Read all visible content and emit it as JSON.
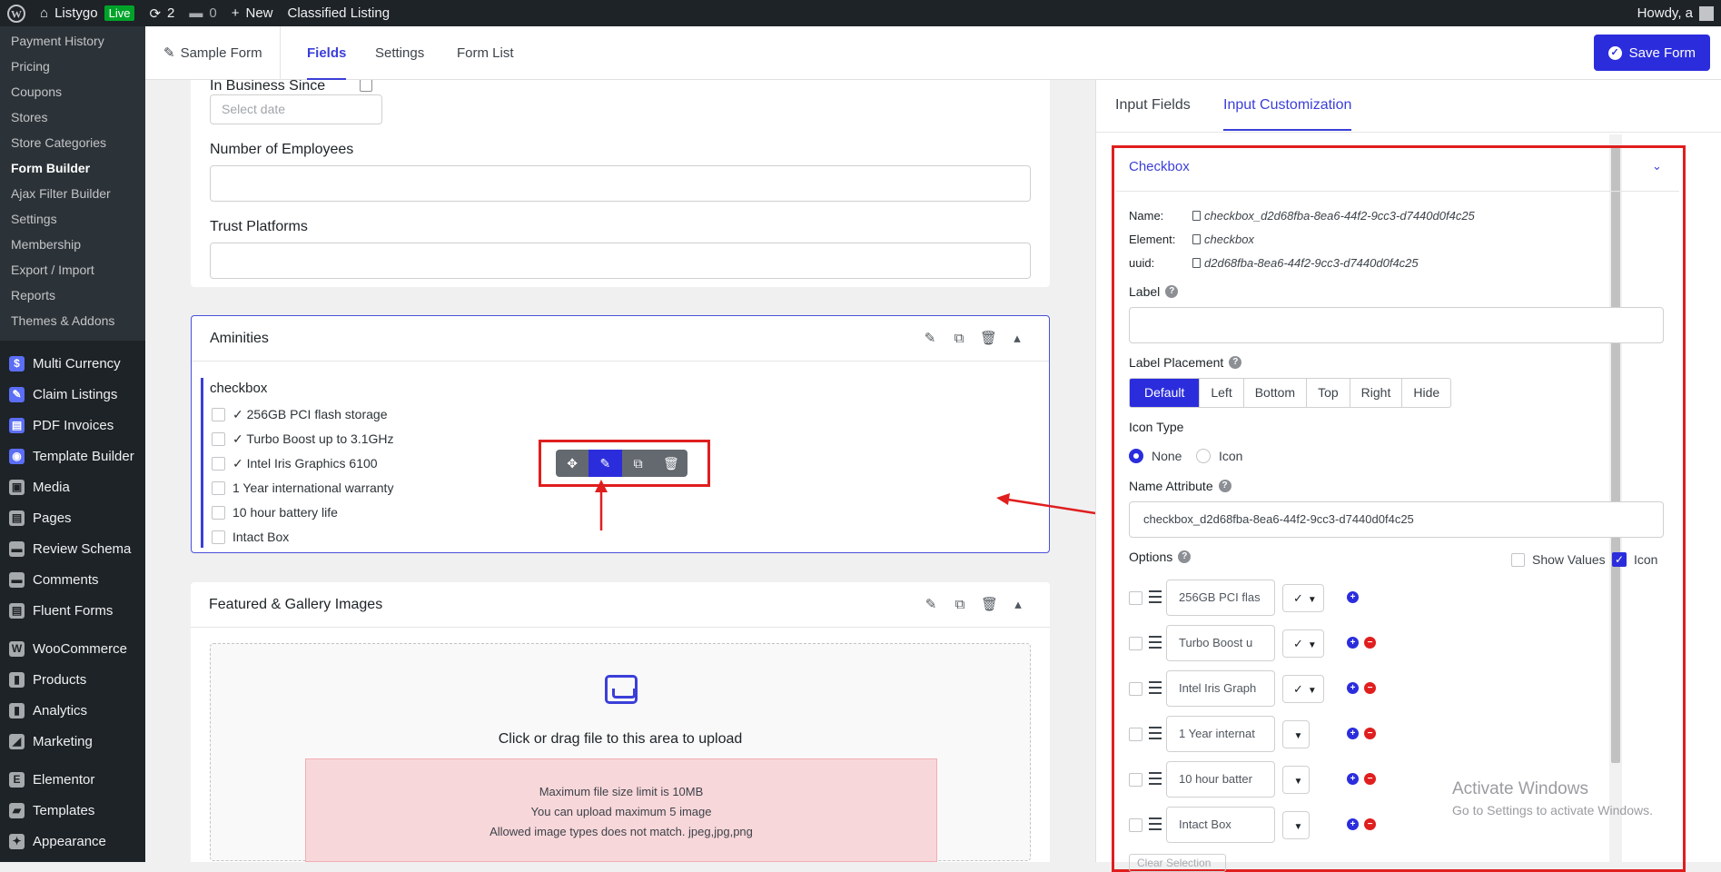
{
  "adminbar": {
    "site_name": "Listygo",
    "live_badge": "Live",
    "updates_count": "2",
    "comments_count": "0",
    "new_label": "New",
    "classified_label": "Classified Listing",
    "howdy": "Howdy, a"
  },
  "sidebar": {
    "sub_items": [
      "Payment History",
      "Pricing",
      "Coupons",
      "Stores",
      "Store Categories",
      "Form Builder",
      "Ajax Filter Builder",
      "Settings",
      "Membership",
      "Export / Import",
      "Reports",
      "Themes & Addons"
    ],
    "active_sub": "Form Builder",
    "main_items": [
      {
        "label": "Multi Currency",
        "icon": "dollar-icon"
      },
      {
        "label": "Claim Listings",
        "icon": "claim-icon"
      },
      {
        "label": "PDF Invoices",
        "icon": "pdf-icon"
      },
      {
        "label": "Template Builder",
        "icon": "template-builder-icon"
      },
      {
        "label": "Media",
        "icon": "media-icon"
      },
      {
        "label": "Pages",
        "icon": "pages-icon"
      },
      {
        "label": "Review Schema",
        "icon": "review-schema-icon"
      },
      {
        "label": "Comments",
        "icon": "comments-icon"
      },
      {
        "label": "Fluent Forms",
        "icon": "fluent-forms-icon"
      },
      {
        "label": "WooCommerce",
        "icon": "woocommerce-icon"
      },
      {
        "label": "Products",
        "icon": "products-icon"
      },
      {
        "label": "Analytics",
        "icon": "analytics-icon"
      },
      {
        "label": "Marketing",
        "icon": "marketing-icon"
      },
      {
        "label": "Elementor",
        "icon": "elementor-icon"
      },
      {
        "label": "Templates",
        "icon": "templates-icon"
      },
      {
        "label": "Appearance",
        "icon": "appearance-icon"
      }
    ]
  },
  "topbar": {
    "form_title": "Sample Form",
    "tabs": [
      "Fields",
      "Settings",
      "Form List"
    ],
    "active_tab": "Fields",
    "save_label": "Save Form"
  },
  "canvas": {
    "business_since_label": "In Business Since",
    "date_placeholder": "Select date",
    "employees_label": "Number of Employees",
    "trust_label": "Trust Platforms",
    "aminities": {
      "title": "Aminities",
      "field_label": "checkbox",
      "options": [
        "✓ 256GB PCI flash storage",
        "✓ Turbo Boost up to 3.1GHz",
        "✓ Intel Iris Graphics 6100",
        "1 Year international warranty",
        "10 hour battery life",
        "Intact Box"
      ]
    },
    "gallery": {
      "title": "Featured & Gallery Images",
      "upload_text": "Click or drag file to this area to upload",
      "notes": [
        "Maximum file size limit is 10MB",
        "You can upload maximum 5 image",
        "Allowed image types does not match. jpeg,jpg,png"
      ]
    }
  },
  "rpanel": {
    "tabs": [
      "Input Fields",
      "Input Customization"
    ],
    "active_tab": "Input Customization",
    "section_title": "Checkbox",
    "meta": {
      "name_key": "Name:",
      "name_val": "checkbox_d2d68fba-8ea6-44f2-9cc3-d7440d0f4c25",
      "element_key": "Element:",
      "element_val": "checkbox",
      "uuid_key": "uuid:",
      "uuid_val": "d2d68fba-8ea6-44f2-9cc3-d7440d0f4c25"
    },
    "label_title": "Label",
    "label_value": "",
    "placement_title": "Label Placement",
    "placements": [
      "Default",
      "Left",
      "Bottom",
      "Top",
      "Right",
      "Hide"
    ],
    "active_placement": "Default",
    "icon_type_title": "Icon Type",
    "icon_types": [
      "None",
      "Icon"
    ],
    "active_icon_type": "None",
    "name_attr_title": "Name Attribute",
    "name_attr_value": "checkbox_d2d68fba-8ea6-44f2-9cc3-d7440d0f4c25",
    "options_title": "Options",
    "show_values_label": "Show Values",
    "show_values_checked": false,
    "icon_label": "Icon",
    "icon_checked": true,
    "options": [
      {
        "value": "256GB PCI flas",
        "icon": "✓"
      },
      {
        "value": "Turbo Boost u",
        "icon": "✓"
      },
      {
        "value": "Intel Iris Graph",
        "icon": "✓"
      },
      {
        "value": "1 Year internat",
        "icon": ""
      },
      {
        "value": "10 hour batter",
        "icon": ""
      },
      {
        "value": "Intact Box",
        "icon": ""
      }
    ],
    "clear_selection": "Clear Selection"
  },
  "watermark": {
    "line1": "Activate Windows",
    "line2": "Go to Settings to activate Windows."
  },
  "colors": {
    "accent": "#2b2ddd",
    "highlight_red": "#e01e1e",
    "admin_dark": "#1d2327"
  }
}
